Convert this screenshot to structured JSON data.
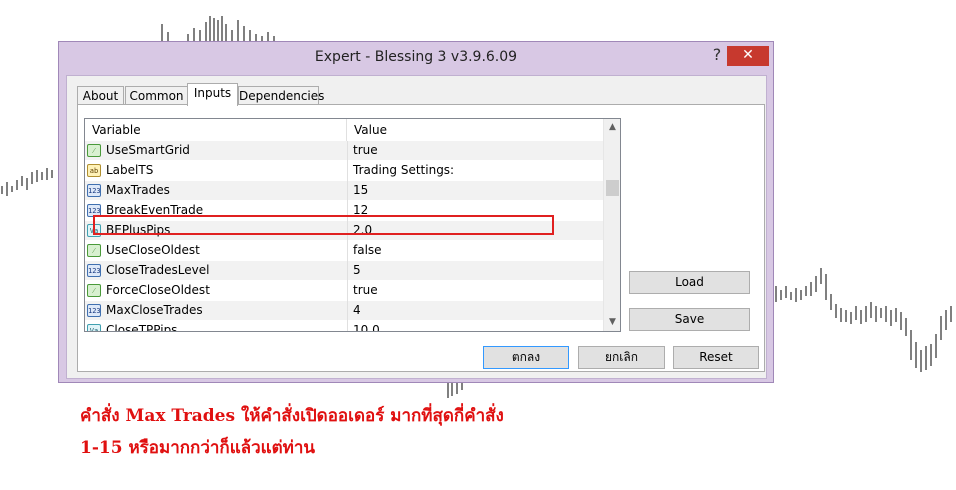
{
  "window": {
    "title": "Expert - Blessing 3 v3.9.6.09",
    "help_glyph": "?",
    "close_glyph": "✕"
  },
  "tabs": [
    {
      "label": "About"
    },
    {
      "label": "Common"
    },
    {
      "label": "Inputs",
      "active": true
    },
    {
      "label": "Dependencies"
    }
  ],
  "grid": {
    "headers": {
      "variable": "Variable",
      "value": "Value"
    },
    "rows": [
      {
        "icon": "bool-icon",
        "icon_glyph": "⁄",
        "variable": "UseSmartGrid",
        "value": "true"
      },
      {
        "icon": "string-icon",
        "icon_glyph": "ab",
        "variable": "LabelTS",
        "value": "Trading Settings:"
      },
      {
        "icon": "integer-icon",
        "icon_glyph": "123",
        "variable": "MaxTrades",
        "value": "15",
        "highlighted": true
      },
      {
        "icon": "integer-icon",
        "icon_glyph": "123",
        "variable": "BreakEvenTrade",
        "value": "12"
      },
      {
        "icon": "double-icon",
        "icon_glyph": "Va",
        "variable": "BEPlusPips",
        "value": "2.0"
      },
      {
        "icon": "bool-icon",
        "icon_glyph": "⁄",
        "variable": "UseCloseOldest",
        "value": "false"
      },
      {
        "icon": "integer-icon",
        "icon_glyph": "123",
        "variable": "CloseTradesLevel",
        "value": "5"
      },
      {
        "icon": "bool-icon",
        "icon_glyph": "⁄",
        "variable": "ForceCloseOldest",
        "value": "true"
      },
      {
        "icon": "integer-icon",
        "icon_glyph": "123",
        "variable": "MaxCloseTrades",
        "value": "4"
      },
      {
        "icon": "double-icon",
        "icon_glyph": "Va",
        "variable": "CloseTPPips",
        "value": "10.0"
      }
    ],
    "scroll_up_glyph": "▲",
    "scroll_down_glyph": "▼"
  },
  "side_buttons": {
    "load": "Load",
    "save": "Save"
  },
  "bottom_buttons": {
    "ok": "ตกลง",
    "cancel": "ยกเลิก",
    "reset": "Reset"
  },
  "caption": {
    "line1": "คำสั่ง Max Trades  ให้คำสั่งเปิดออเดอร์ มากที่สุดกี่คำสั่ง",
    "line2": "1-15 หรือมากกว่าก็แล้วแต่ท่าน"
  },
  "colors": {
    "highlight": "#e02020",
    "caption": "#e01010",
    "close_button": "#c7392e"
  }
}
